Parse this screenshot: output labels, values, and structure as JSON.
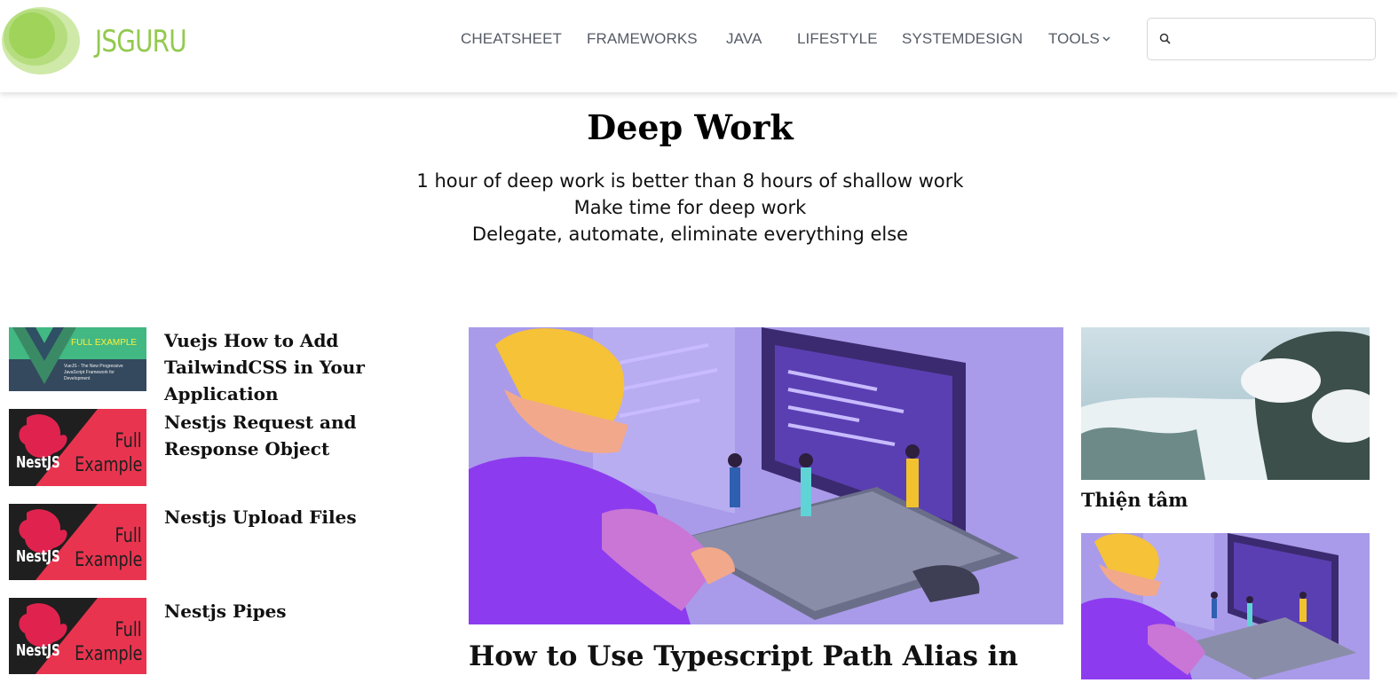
{
  "header": {
    "brand": "JSGURU",
    "nav": [
      {
        "label": "CHEATSHEET"
      },
      {
        "label": "FRAMEWORKS"
      },
      {
        "label": "JAVA"
      },
      {
        "label": "LIFESTYLE"
      },
      {
        "label": "SYSTEMDESIGN"
      },
      {
        "label": "TOOLS"
      }
    ],
    "search": {
      "placeholder": "",
      "value": "",
      "icon": "search-icon"
    },
    "logo_color": "#93c94f"
  },
  "hero": {
    "title": "Deep Work",
    "lines": [
      "1 hour of deep work is better than 8 hours of shallow work",
      "Make time for deep work",
      "Delegate, automate, eliminate everything else"
    ]
  },
  "posts": [
    {
      "title": "Vuejs How to Add TailwindCSS in Your Application",
      "badge": "FULL EXAMPLE",
      "caption": "VueJS - The New Progressive JavaScript Framework for Development"
    },
    {
      "title": "Nestjs Request and Response Object",
      "logo_text": "NestJS",
      "badge_line1": "Full",
      "badge_line2": "Example"
    },
    {
      "title": "Nestjs Upload Files",
      "logo_text": "NestJS",
      "badge_line1": "Full",
      "badge_line2": "Example"
    },
    {
      "title": "Nestjs Pipes",
      "logo_text": "NestJS",
      "badge_line1": "Full",
      "badge_line2": "Example"
    }
  ],
  "featured": {
    "title": "How to Use Typescript Path Alias in"
  },
  "sidebar": {
    "items": [
      {
        "title": "Thiện tâm"
      }
    ]
  },
  "colors": {
    "accent": "#93c94f",
    "nest_red": "#e0234e",
    "purple_bg": "#a99bea",
    "vue_green": "#42b883"
  }
}
